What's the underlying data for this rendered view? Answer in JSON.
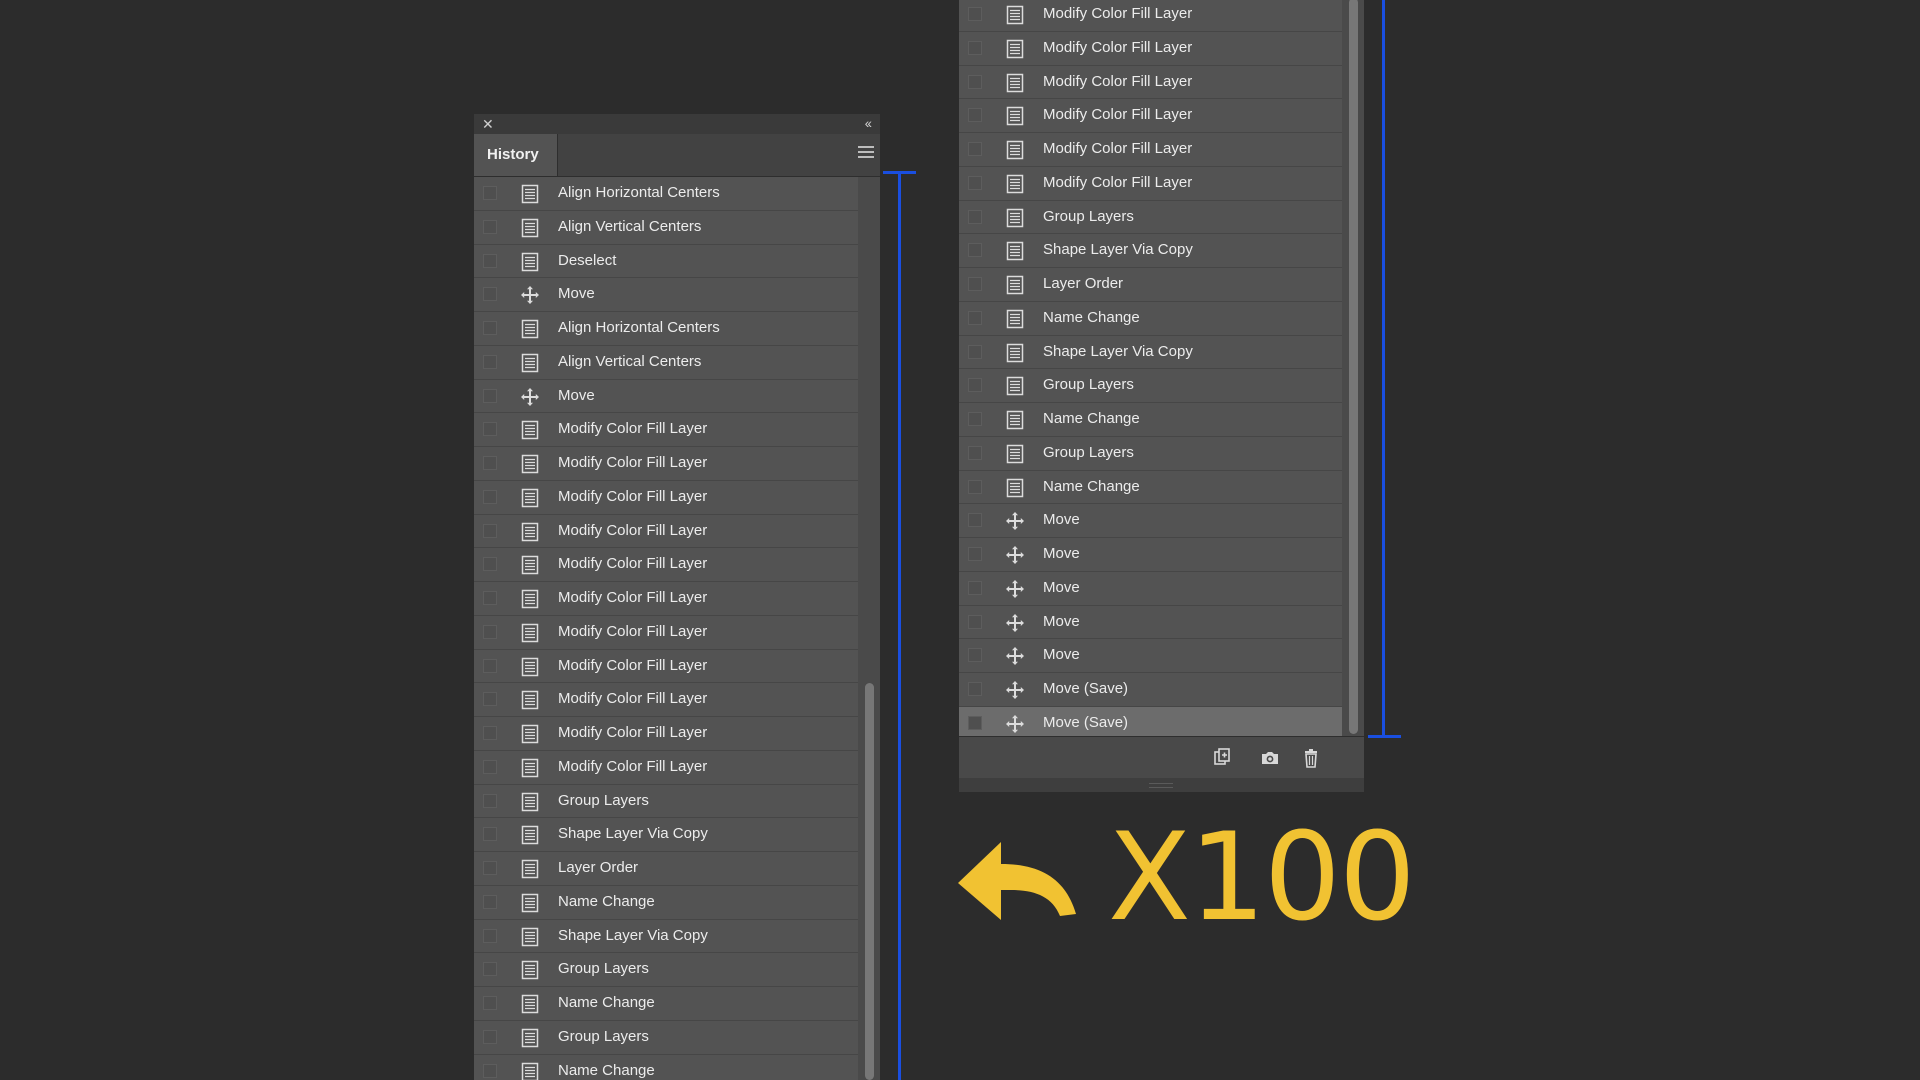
{
  "left_panel": {
    "tab_title": "History",
    "rows": [
      {
        "label": "Align Horizontal Centers",
        "icon": "document-icon"
      },
      {
        "label": "Align Vertical Centers",
        "icon": "document-icon"
      },
      {
        "label": "Deselect",
        "icon": "document-icon"
      },
      {
        "label": "Move",
        "icon": "move-icon"
      },
      {
        "label": "Align Horizontal Centers",
        "icon": "document-icon"
      },
      {
        "label": "Align Vertical Centers",
        "icon": "document-icon"
      },
      {
        "label": "Move",
        "icon": "move-icon"
      },
      {
        "label": "Modify Color Fill Layer",
        "icon": "document-icon"
      },
      {
        "label": "Modify Color Fill Layer",
        "icon": "document-icon"
      },
      {
        "label": "Modify Color Fill Layer",
        "icon": "document-icon"
      },
      {
        "label": "Modify Color Fill Layer",
        "icon": "document-icon"
      },
      {
        "label": "Modify Color Fill Layer",
        "icon": "document-icon"
      },
      {
        "label": "Modify Color Fill Layer",
        "icon": "document-icon"
      },
      {
        "label": "Modify Color Fill Layer",
        "icon": "document-icon"
      },
      {
        "label": "Modify Color Fill Layer",
        "icon": "document-icon"
      },
      {
        "label": "Modify Color Fill Layer",
        "icon": "document-icon"
      },
      {
        "label": "Modify Color Fill Layer",
        "icon": "document-icon"
      },
      {
        "label": "Modify Color Fill Layer",
        "icon": "document-icon"
      },
      {
        "label": "Group Layers",
        "icon": "document-icon"
      },
      {
        "label": "Shape Layer Via Copy",
        "icon": "document-icon"
      },
      {
        "label": "Layer Order",
        "icon": "document-icon"
      },
      {
        "label": "Name Change",
        "icon": "document-icon"
      },
      {
        "label": "Shape Layer Via Copy",
        "icon": "document-icon"
      },
      {
        "label": "Group Layers",
        "icon": "document-icon"
      },
      {
        "label": "Name Change",
        "icon": "document-icon"
      },
      {
        "label": "Group Layers",
        "icon": "document-icon"
      },
      {
        "label": "Name Change",
        "icon": "document-icon"
      }
    ]
  },
  "right_panel": {
    "rows": [
      {
        "label": "Modify Color Fill Layer",
        "icon": "document-icon"
      },
      {
        "label": "Modify Color Fill Layer",
        "icon": "document-icon"
      },
      {
        "label": "Modify Color Fill Layer",
        "icon": "document-icon"
      },
      {
        "label": "Modify Color Fill Layer",
        "icon": "document-icon"
      },
      {
        "label": "Modify Color Fill Layer",
        "icon": "document-icon"
      },
      {
        "label": "Modify Color Fill Layer",
        "icon": "document-icon"
      },
      {
        "label": "Group Layers",
        "icon": "document-icon"
      },
      {
        "label": "Shape Layer Via Copy",
        "icon": "document-icon"
      },
      {
        "label": "Layer Order",
        "icon": "document-icon"
      },
      {
        "label": "Name Change",
        "icon": "document-icon"
      },
      {
        "label": "Shape Layer Via Copy",
        "icon": "document-icon"
      },
      {
        "label": "Group Layers",
        "icon": "document-icon"
      },
      {
        "label": "Name Change",
        "icon": "document-icon"
      },
      {
        "label": "Group Layers",
        "icon": "document-icon"
      },
      {
        "label": "Name Change",
        "icon": "document-icon"
      },
      {
        "label": "Move",
        "icon": "move-icon"
      },
      {
        "label": "Move",
        "icon": "move-icon"
      },
      {
        "label": "Move",
        "icon": "move-icon"
      },
      {
        "label": "Move",
        "icon": "move-icon"
      },
      {
        "label": "Move",
        "icon": "move-icon"
      },
      {
        "label": "Move (Save)",
        "icon": "move-icon"
      },
      {
        "label": "Move (Save)",
        "icon": "move-icon",
        "selected": true
      }
    ],
    "footer_icons": [
      "new-document-from-state-icon",
      "camera-icon",
      "trash-icon"
    ]
  },
  "annotation": {
    "text": "X100",
    "icon": "undo-arrow-icon",
    "accent_color": "#f1c232",
    "bracket_color": "#1a4fe0"
  },
  "colors": {
    "background": "#2c2c2c",
    "panel": "#535353",
    "selected_row": "#6c6c6c"
  }
}
